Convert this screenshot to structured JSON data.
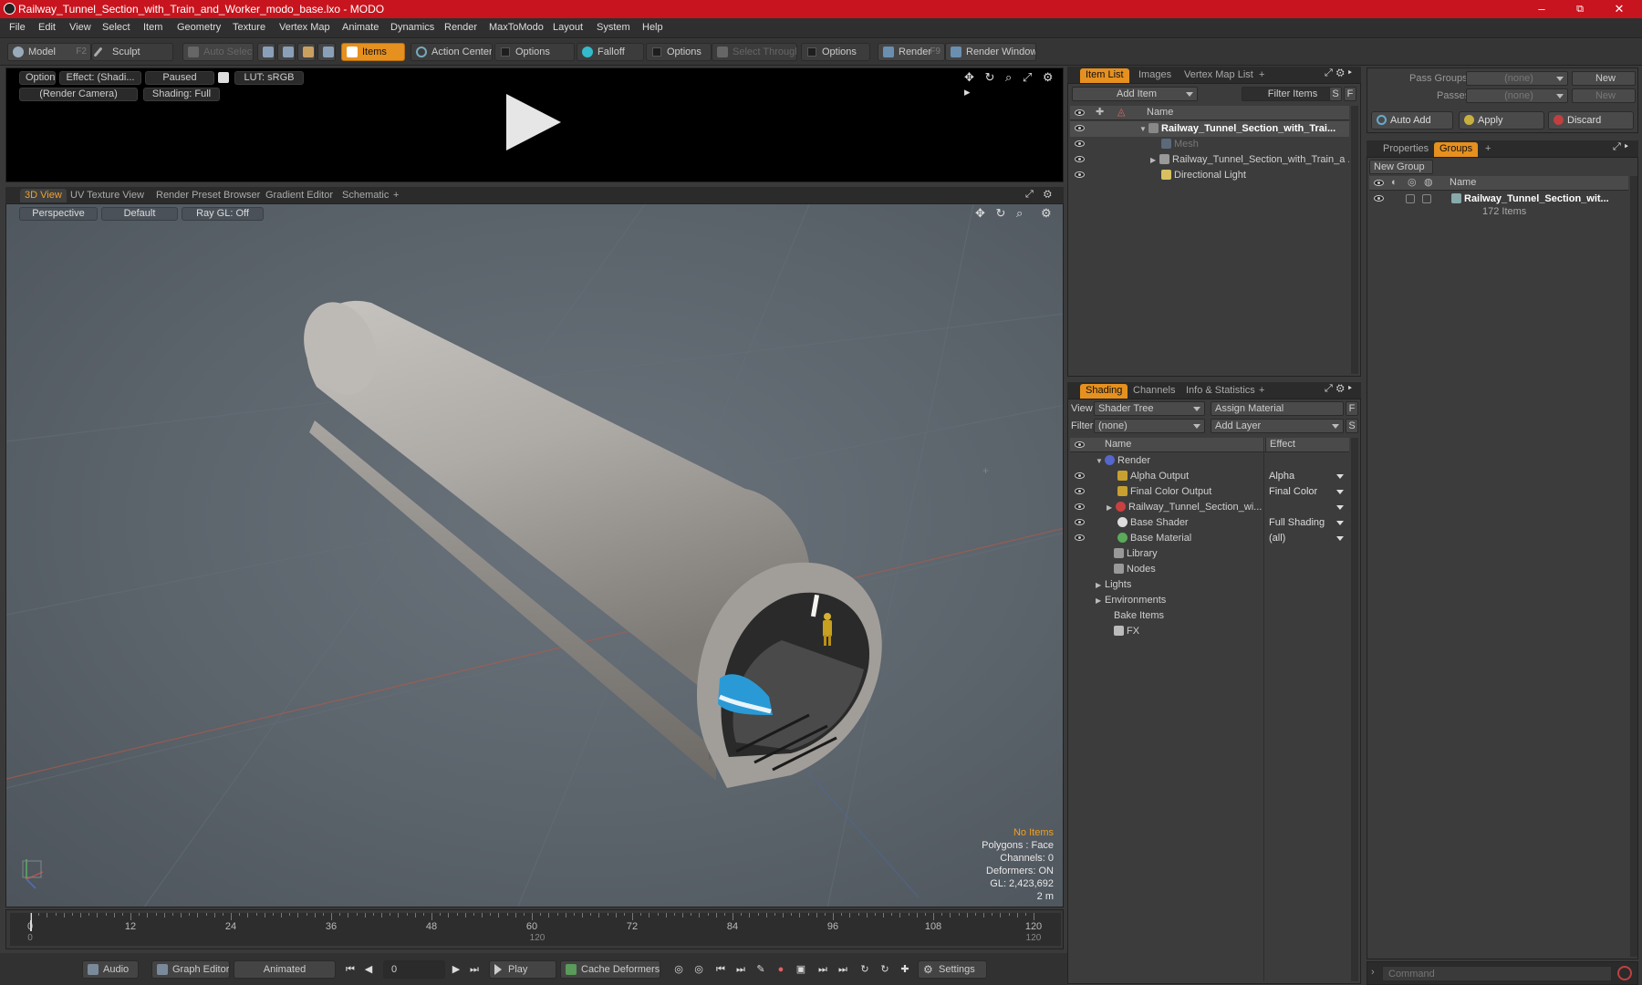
{
  "window": {
    "title": "Railway_Tunnel_Section_with_Train_and_Worker_modo_base.lxo - MODO",
    "minimize": "–",
    "maximize": "⧉",
    "close": "✕"
  },
  "menu": [
    "File",
    "Edit",
    "View",
    "Select",
    "Item",
    "Geometry",
    "Texture",
    "Vertex Map",
    "Animate",
    "Dynamics",
    "Render",
    "MaxToModo",
    "Layout",
    "System",
    "Help"
  ],
  "toolbar": {
    "model": "Model",
    "model_key": "F2",
    "sculpt": "Sculpt",
    "auto_select": "Auto Select",
    "items": "Items",
    "action_center": "Action Center",
    "options1": "Options",
    "falloff": "Falloff",
    "options2": "Options",
    "select_through": "Select Through",
    "options3": "Options",
    "render": "Render",
    "render_key": "F9",
    "render_window": "Render Window"
  },
  "preview": {
    "options": "Options",
    "effect": "Effect: (Shadi...",
    "paused": "Paused",
    "lut": "LUT: sRGB",
    "camera": "(Render Camera)",
    "shading": "Shading: Full"
  },
  "view_tabs": [
    "3D View",
    "UV Texture View",
    "Render Preset Browser",
    "Gradient Editor",
    "Schematic",
    "+"
  ],
  "viewport": {
    "perspective": "Perspective",
    "default": "Default",
    "raygl": "Ray GL: Off",
    "stats": {
      "no_items": "No Items",
      "polygons": "Polygons : Face",
      "channels": "Channels: 0",
      "deformers": "Deformers: ON",
      "gl": "GL: 2,423,692",
      "scale": "2 m"
    }
  },
  "timeline": {
    "labels": [
      "0",
      "12",
      "24",
      "36",
      "48",
      "60",
      "72",
      "84",
      "96",
      "108",
      "120"
    ],
    "start": "0",
    "end": "120",
    "mid": "120"
  },
  "transport": {
    "audio": "Audio",
    "graph_editor": "Graph Editor",
    "animated": "Animated",
    "frame": "0",
    "play": "Play",
    "cache_deformers": "Cache Deformers",
    "settings": "Settings"
  },
  "item_list": {
    "tabs": [
      "Item List",
      "Images",
      "Vertex Map List",
      "+"
    ],
    "add_item": "Add Item",
    "filter_items": "Filter Items",
    "s": "S",
    "f": "F",
    "col_name": "Name",
    "rows": [
      {
        "label": "Railway_Tunnel_Section_with_Trai...",
        "bold": true
      },
      {
        "label": "Mesh",
        "dim": true
      },
      {
        "label": "Railway_Tunnel_Section_with_Train_a ...",
        "bold": false
      },
      {
        "label": "Directional Light",
        "bold": false
      }
    ]
  },
  "shading": {
    "tabs": [
      "Shading",
      "Channels",
      "Info & Statistics",
      "+"
    ],
    "view_label": "View",
    "view_value": "Shader Tree",
    "assign_material": "Assign Material",
    "filter_label": "Filter",
    "filter_value": "(none)",
    "add_layer": "Add Layer",
    "f": "F",
    "s": "S",
    "col_name": "Name",
    "col_effect": "Effect",
    "rows": [
      {
        "label": "Render",
        "effect": ""
      },
      {
        "label": "Alpha Output",
        "effect": "Alpha"
      },
      {
        "label": "Final Color Output",
        "effect": "Final Color"
      },
      {
        "label": "Railway_Tunnel_Section_wi...",
        "effect": ""
      },
      {
        "label": "Base Shader",
        "effect": "Full Shading"
      },
      {
        "label": "Base Material",
        "effect": "(all)"
      },
      {
        "label": "Library",
        "effect": ""
      },
      {
        "label": "Nodes",
        "effect": ""
      },
      {
        "label": "Lights",
        "effect": ""
      },
      {
        "label": "Environments",
        "effect": ""
      },
      {
        "label": "Bake Items",
        "effect": ""
      },
      {
        "label": "FX",
        "effect": ""
      }
    ]
  },
  "pass_groups": {
    "pass_groups_label": "Pass Groups",
    "pass_groups_value": "(none)",
    "passes_label": "Passes",
    "passes_value": "(none)",
    "new1": "New",
    "new2": "New",
    "auto_add": "Auto Add",
    "apply": "Apply",
    "discard": "Discard"
  },
  "groups": {
    "tabs": [
      "Properties",
      "Groups",
      "+"
    ],
    "new_group": "New Group",
    "col_name": "Name",
    "group_name": "Railway_Tunnel_Section_wit...",
    "group_count": "172 Items"
  },
  "command": {
    "placeholder": "Command"
  },
  "colors": {
    "accent": "#e6901f",
    "title_bar": "#c8141e",
    "viewport": "#5f676f"
  }
}
